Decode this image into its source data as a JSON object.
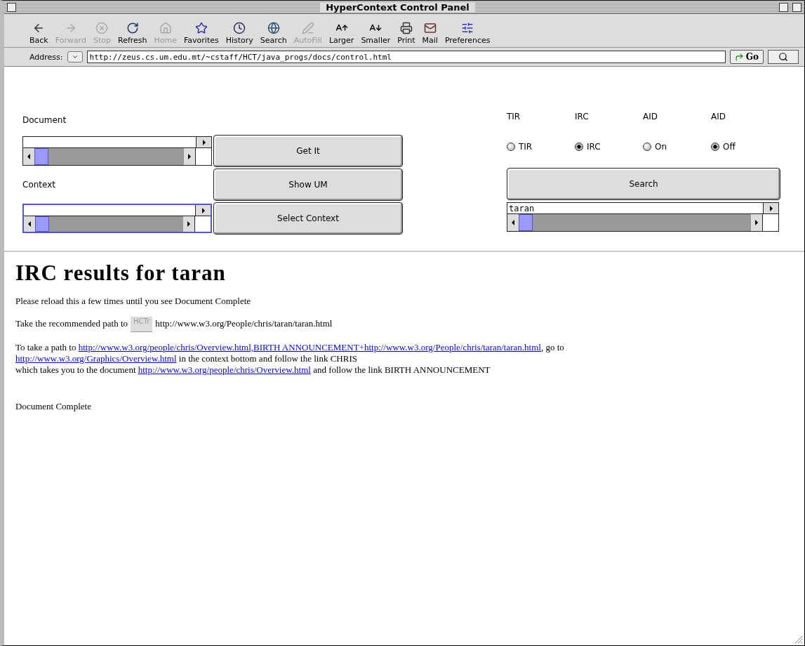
{
  "window": {
    "title": "HyperContext Control Panel"
  },
  "toolbar": [
    {
      "label": "Back",
      "disabled": false
    },
    {
      "label": "Forward",
      "disabled": true
    },
    {
      "label": "Stop",
      "disabled": true
    },
    {
      "label": "Refresh",
      "disabled": false
    },
    {
      "label": "Home",
      "disabled": true
    },
    {
      "label": "Favorites",
      "disabled": false
    },
    {
      "label": "History",
      "disabled": false
    },
    {
      "label": "Search",
      "disabled": false
    },
    {
      "label": "AutoFill",
      "disabled": true
    },
    {
      "label": "Larger",
      "disabled": false
    },
    {
      "label": "Smaller",
      "disabled": false
    },
    {
      "label": "Print",
      "disabled": false
    },
    {
      "label": "Mail",
      "disabled": false
    },
    {
      "label": "Preferences",
      "disabled": false
    }
  ],
  "address_bar": {
    "label": "Address:",
    "value": "http://zeus.cs.um.edu.mt/~cstaff/HCT/java_progs/docs/control.html",
    "go": "Go"
  },
  "form": {
    "document_label": "Document",
    "context_label": "Context",
    "document_field": {
      "focused": false
    },
    "context_field": {
      "focused": true
    },
    "buttons": [
      "Get It",
      "Show UM",
      "Select Context"
    ],
    "radio_columns": [
      {
        "heading": "TIR",
        "label": "TIR",
        "selected": false
      },
      {
        "heading": "IRC",
        "label": "IRC",
        "selected": true
      },
      {
        "heading": "AID",
        "label": "On",
        "selected": false
      },
      {
        "heading": "AID",
        "label": "Off",
        "selected": true
      }
    ],
    "search_button": "Search",
    "search_field": {
      "value": "taran",
      "focused": false
    }
  },
  "content": {
    "heading": "IRC results for taran",
    "paragraphs": [
      [
        {
          "kind": "text",
          "text": "Please reload this a few times until you see Document Complete"
        }
      ],
      [
        {
          "kind": "text",
          "text": "Take the recommended path to"
        },
        {
          "kind": "button",
          "text": "HCTr"
        },
        {
          "kind": "text",
          "text": "http://www.w3.org/People/chris/taran/taran.html"
        }
      ],
      [
        {
          "kind": "text",
          "text": "To take a path to "
        },
        {
          "kind": "link",
          "text": "http://www.w3.org/people/chris/Overview.html,BIRTH ANNOUNCEMENT+http://www.w3.org/People/chris/taran/taran.html"
        },
        {
          "kind": "text",
          "text": ", go to"
        },
        {
          "kind": "break"
        },
        {
          "kind": "link",
          "text": "http://www.w3.org/Graphics/Overview.html"
        },
        {
          "kind": "text",
          "text": " in the context bottom and follow the link CHRIS"
        },
        {
          "kind": "break"
        },
        {
          "kind": "text",
          "text": "which takes you to the document "
        },
        {
          "kind": "link",
          "text": "http://www.w3.org/people/chris/Overview.html"
        },
        {
          "kind": "text",
          "text": " and follow the link BIRTH ANNOUNCEMENT"
        }
      ]
    ],
    "status": "Document Complete"
  }
}
